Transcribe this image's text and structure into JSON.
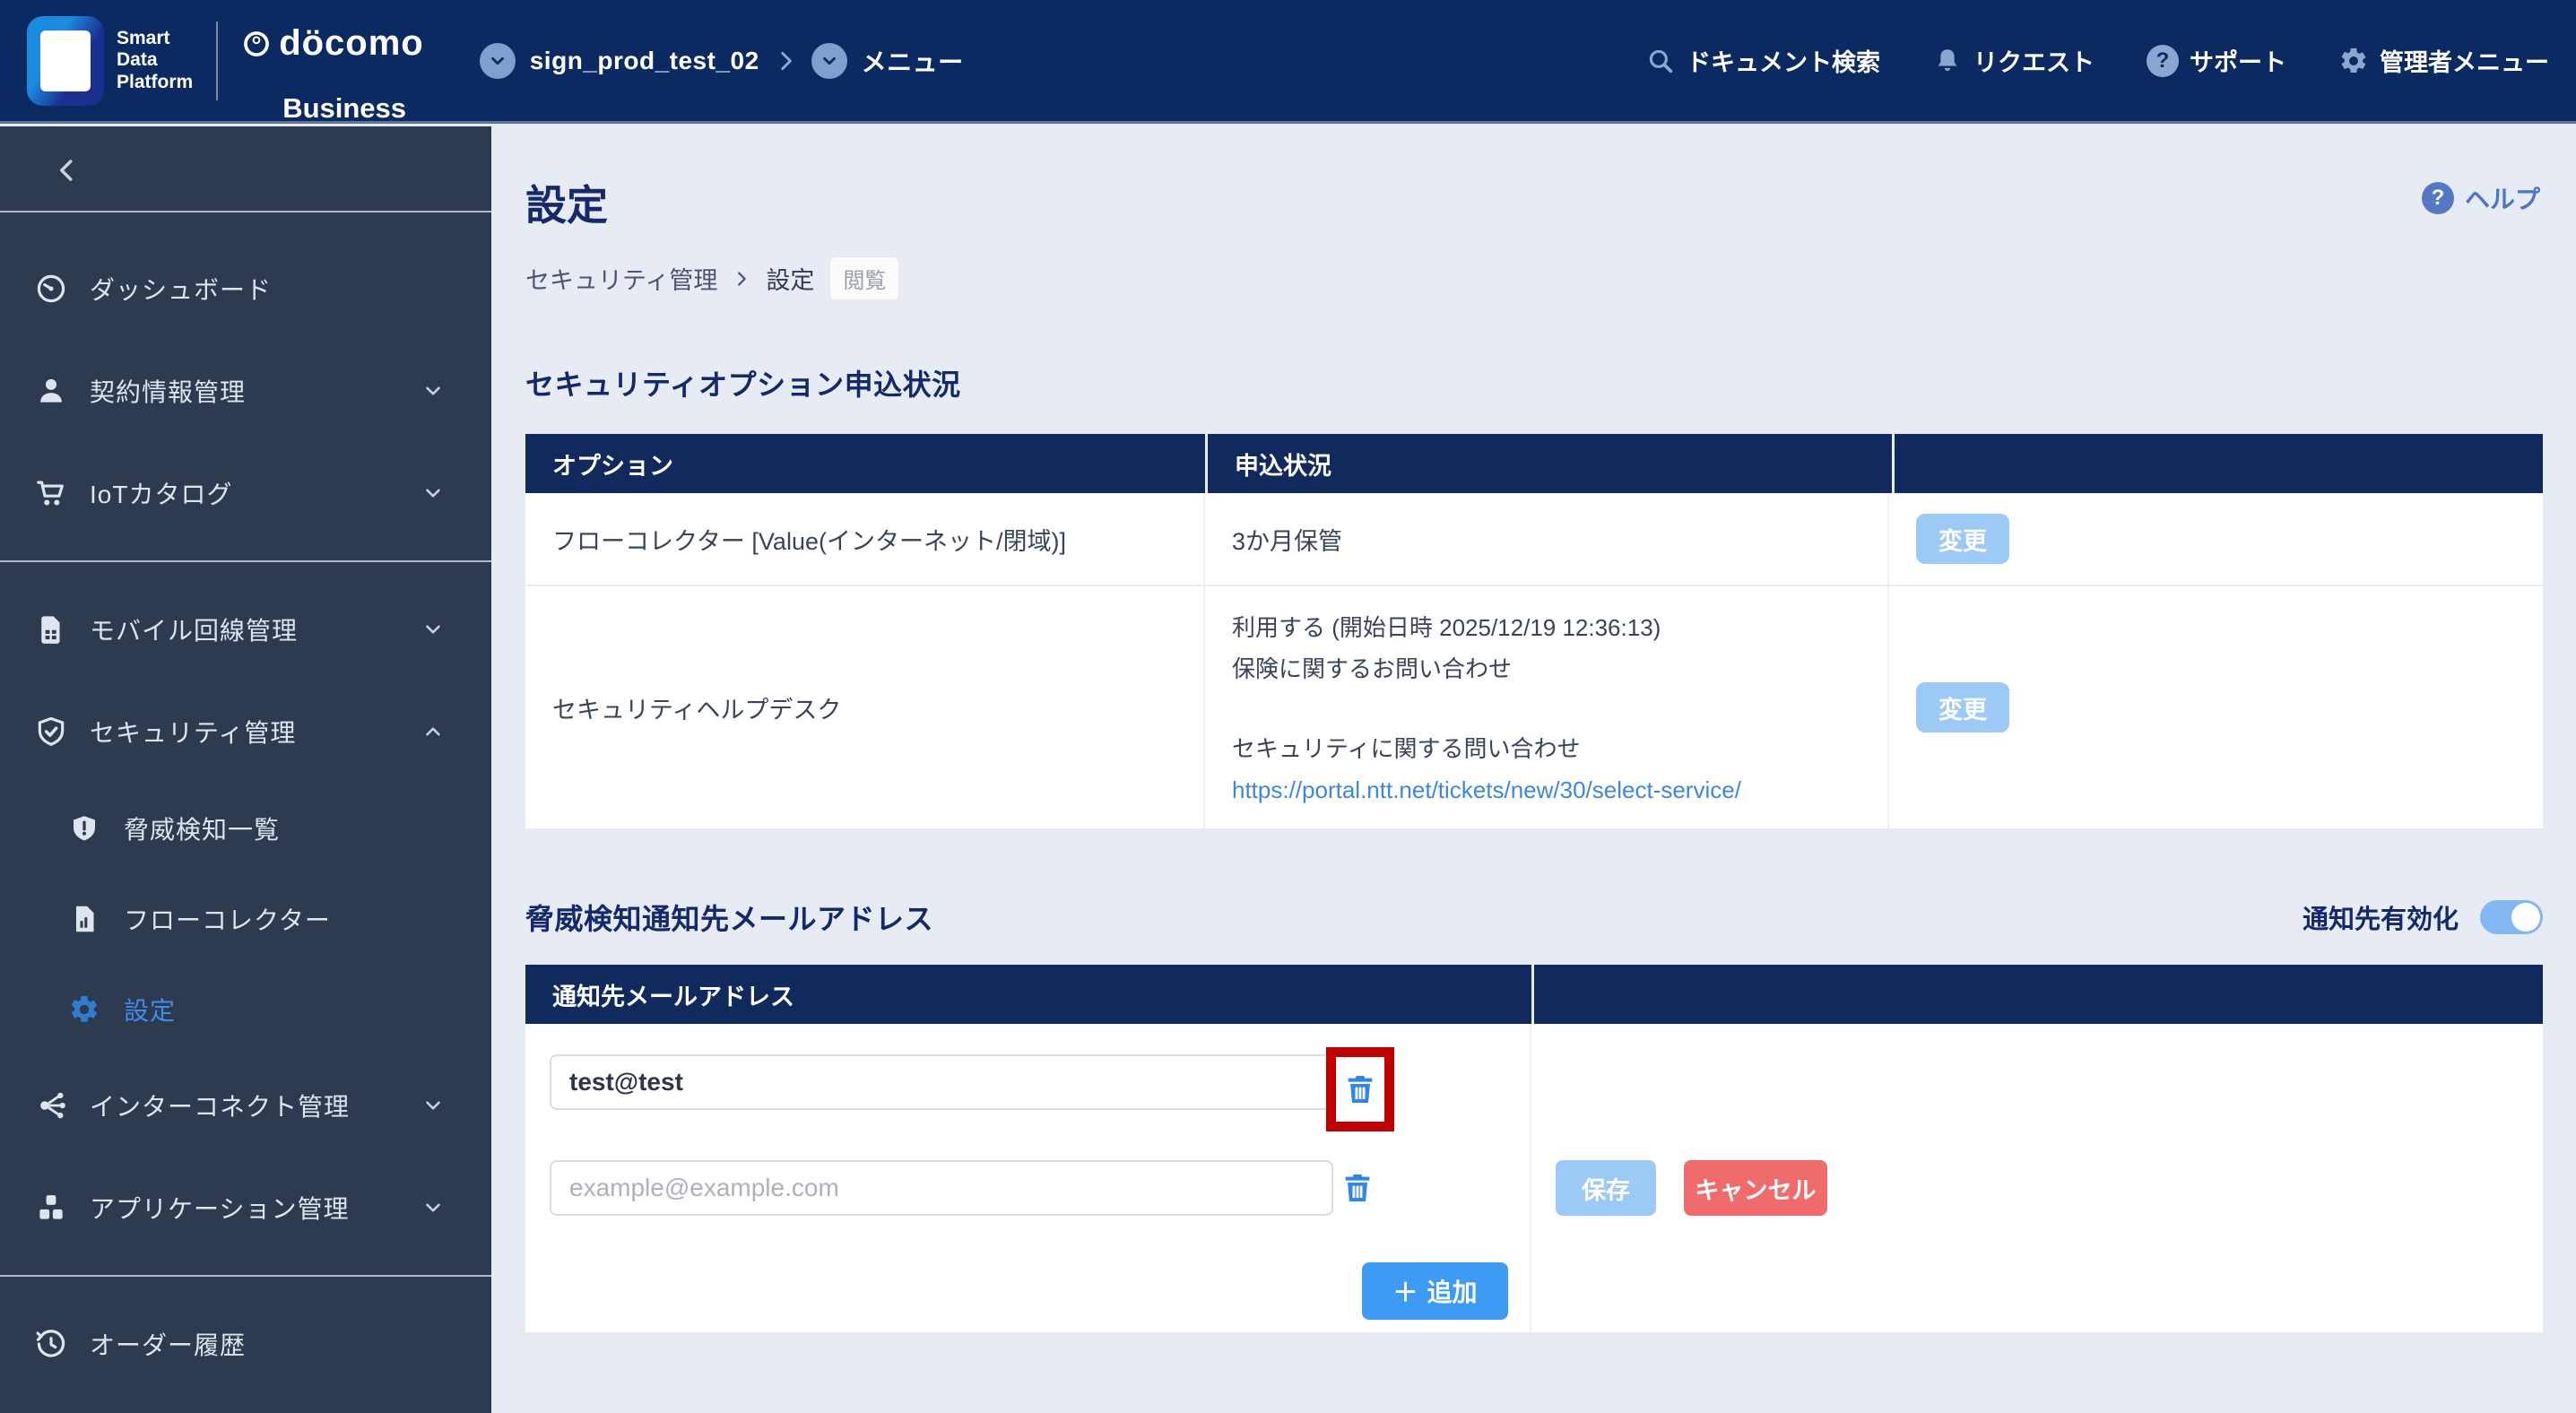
{
  "header": {
    "brand": {
      "line1": "Smart",
      "line2": "Data",
      "line3": "Platform",
      "docomo": "döcomo",
      "business": "Business"
    },
    "workspace": "sign_prod_test_02",
    "menu": "メニュー",
    "nav": [
      {
        "label": "ドキュメント検索"
      },
      {
        "label": "リクエスト"
      },
      {
        "label": "サポート"
      },
      {
        "label": "管理者メニュー"
      }
    ]
  },
  "sidebar": {
    "items": [
      {
        "label": "ダッシュボード"
      },
      {
        "label": "契約情報管理"
      },
      {
        "label": "IoTカタログ"
      },
      {
        "label": "モバイル回線管理"
      },
      {
        "label": "セキュリティ管理"
      },
      {
        "label": "脅威検知一覧"
      },
      {
        "label": "フローコレクター"
      },
      {
        "label": "設定"
      },
      {
        "label": "インターコネクト管理"
      },
      {
        "label": "アプリケーション管理"
      },
      {
        "label": "オーダー履歴"
      }
    ]
  },
  "page": {
    "title": "設定",
    "breadcrumb_parent": "セキュリティ管理",
    "breadcrumb_current": "設定",
    "view_badge": "閲覧",
    "help": "ヘルプ"
  },
  "section_options": {
    "heading": "セキュリティオプション申込状況",
    "col_option": "オプション",
    "col_status": "申込状況",
    "rows": [
      {
        "option": "フローコレクター [Value(インターネット/閉域)]",
        "status": "3か月保管",
        "action": "変更"
      },
      {
        "option": "セキュリティヘルプデスク",
        "line1": "利用する (開始日時 2025/12/19 12:36:13)",
        "line2": "保険に関するお問い合わせ",
        "line3": "セキュリティに関する問い合わせ",
        "link": "https://portal.ntt.net/tickets/new/30/select-service/",
        "action": "変更"
      }
    ]
  },
  "section_notify": {
    "heading": "脅威検知通知先メールアドレス",
    "toggle_label": "通知先有効化",
    "toggle_state": "on",
    "col_email": "通知先メールアドレス",
    "email_value": "test@test",
    "email_placeholder": "example@example.com",
    "add": "追加",
    "save": "保存",
    "cancel": "キャンセル",
    "plus": "＋"
  },
  "colors": {
    "topbar_navy": "#0C2A62",
    "table_header_navy": "#12295E",
    "sidebar_slate": "#2D3A50",
    "active_blue": "#3E8EE8",
    "light_blue_button": "#9CC9F5",
    "primary_blue_button": "#3E9BF4",
    "cancel_red": "#F06B6B",
    "highlight_annotation_red": "#C00000",
    "link_blue": "#3C86E8"
  }
}
